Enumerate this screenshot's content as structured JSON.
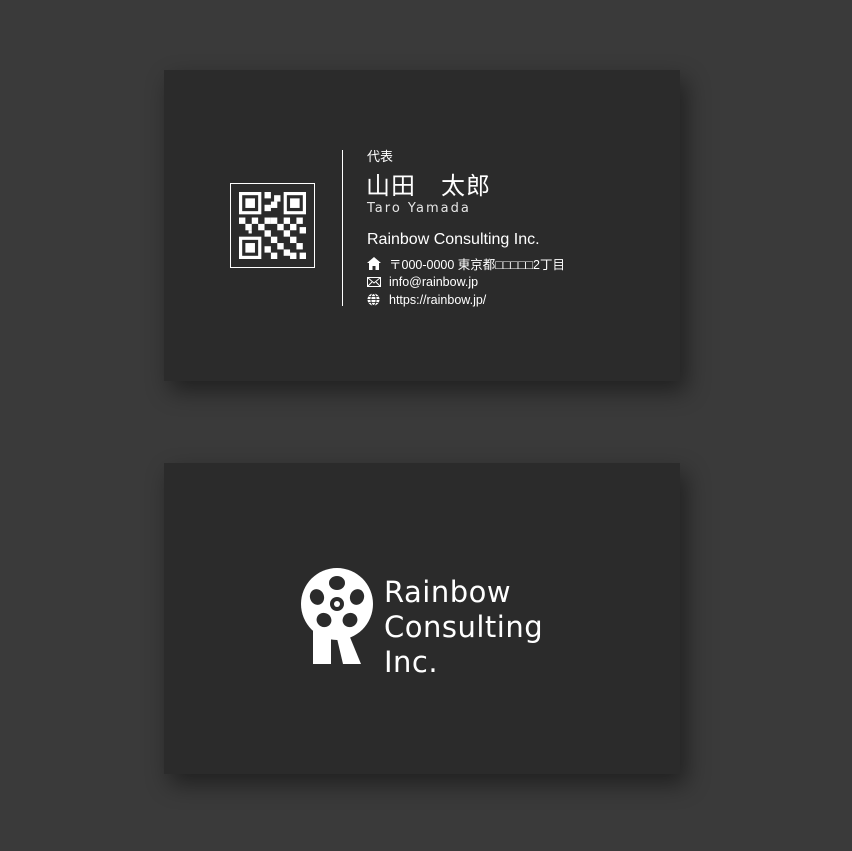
{
  "front": {
    "role": "代表",
    "name_jp": "山田　太郎",
    "name_en": "Taro  Yamada",
    "company": "Rainbow Consulting Inc.",
    "address": "〒000-0000 東京都□□□□□2丁目",
    "email": "info@rainbow.jp",
    "website": "https://rainbow.jp/",
    "icons": [
      "home-icon",
      "mail-icon",
      "globe-icon",
      "qr-code"
    ]
  },
  "back": {
    "logo_line1": "Rainbow",
    "logo_line2": "Consulting",
    "logo_line3": "Inc.",
    "icons": [
      "flower-r-logo"
    ]
  },
  "colors": {
    "background": "#3a3a3a",
    "card": "#2b2b2b",
    "text": "#ffffff"
  }
}
